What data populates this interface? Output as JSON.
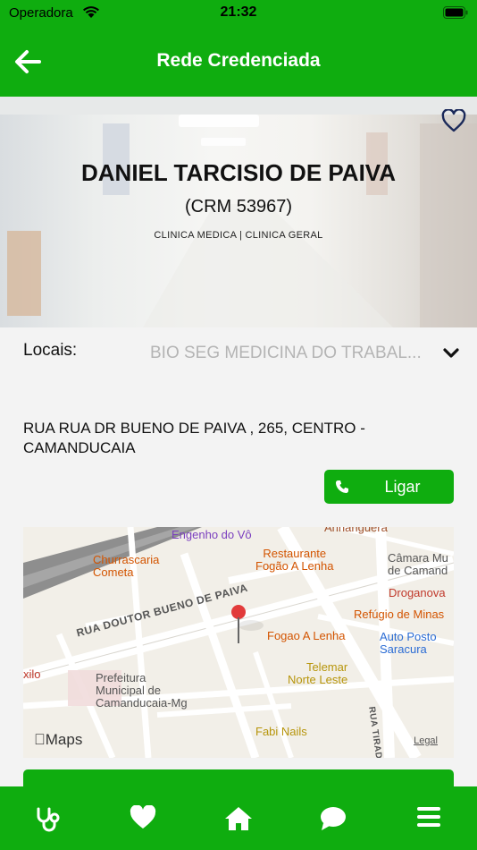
{
  "status_bar": {
    "carrier": "Operadora",
    "time": "21:32"
  },
  "header": {
    "title": "Rede Credenciada"
  },
  "doctor": {
    "name": "DANIEL TARCISIO DE PAIVA",
    "crm": "(CRM 53967)",
    "specialties": "CLINICA MEDICA | CLINICA GERAL"
  },
  "locais": {
    "label": "Locais:",
    "selected": "BIO SEG MEDICINA DO TRABAL..."
  },
  "address": "RUA RUA DR BUENO DE PAIVA , 265, CENTRO - CAMANDUCAIA",
  "call_button": {
    "label": "Ligar"
  },
  "map": {
    "streets": {
      "main": "RUA DOUTOR BUENO DE PAIVA",
      "side": "RUA TIRADE"
    },
    "places": {
      "engenho": "Engenho do Vô",
      "anhanguera": "Anhanguera",
      "churrascaria": "Churrascaria\nCometa",
      "restaurante": "Restaurante\nFogão A Lenha",
      "camara": "Câmara Mu\nde Camand",
      "droganova": "Droganova",
      "refugio": "Refúgio de Minas",
      "fogao": "Fogao A Lenha",
      "auto_posto": "Auto Posto\nSaracura",
      "xilo": "xilo",
      "prefeitura": "Prefeitura\nMunicipal de\nCamanducaia-Mg",
      "telemar": "Telemar\nNorte Leste",
      "fabi": "Fabi Nails"
    },
    "brand": "Maps",
    "legal": "Legal"
  },
  "tabs": [
    "stethoscope-icon",
    "heart-icon",
    "home-icon",
    "chat-icon",
    "menu-icon"
  ],
  "colors": {
    "primary": "#0fad0f",
    "text": "#111111",
    "placeholder": "#b4b4b4"
  }
}
